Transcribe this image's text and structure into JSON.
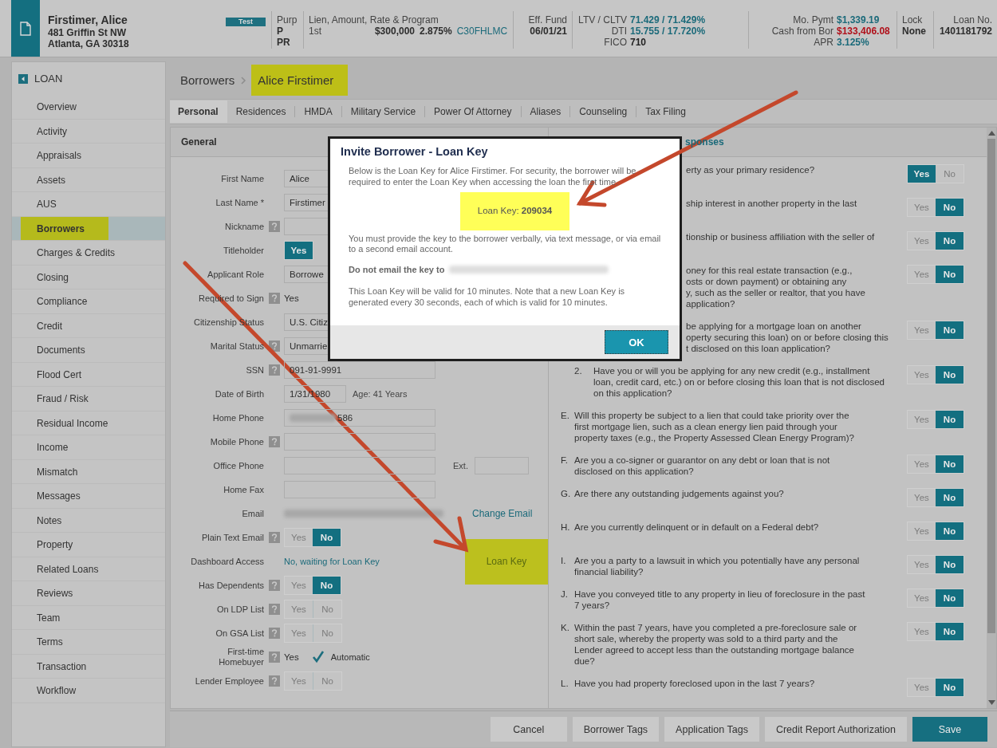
{
  "header": {
    "name": "Firstimer, Alice",
    "address": [
      "481 Griffin St NW",
      "Atlanta, GA 30318"
    ],
    "badge": "Test",
    "purpose": {
      "label": "Purp",
      "values": [
        "P",
        "PR"
      ]
    },
    "lien": {
      "label": "Lien, Amount, Rate & Program",
      "position": "1st",
      "amount": "$300,000",
      "rate": "2.875%",
      "program": "C30FHLMC"
    },
    "funding": {
      "label": "Eff. Fund",
      "value": "06/01/21"
    },
    "ratios": [
      {
        "label": "LTV / CLTV",
        "value": "71.429 / 71.429%",
        "color": "#1b6a7a"
      },
      {
        "label": "DTI",
        "value": "15.755 / 17.720%",
        "color": "#1b6a7a"
      },
      {
        "label": "FICO",
        "value": "710",
        "color": "#222222"
      }
    ],
    "payment": [
      {
        "label": "Mo. Pymt",
        "value": "$1,339.19",
        "color": "#1b6a7a"
      },
      {
        "label": "Cash from Bor",
        "value": "$133,406.08",
        "color": "#b0101a"
      },
      {
        "label": "APR",
        "value": "3.125%",
        "color": "#1b6a7a"
      }
    ],
    "lock": {
      "label": "Lock",
      "value": "None"
    },
    "loan_no": {
      "label": "Loan No.",
      "value": "1401181792"
    }
  },
  "sidebar": {
    "title": "LOAN",
    "items": [
      {
        "label": "Overview",
        "selected": false,
        "highlighted": false
      },
      {
        "label": "Activity",
        "selected": false,
        "highlighted": false
      },
      {
        "label": "Appraisals",
        "selected": false,
        "highlighted": false
      },
      {
        "label": "Assets",
        "selected": false,
        "highlighted": false
      },
      {
        "label": "AUS",
        "selected": false,
        "highlighted": false
      },
      {
        "label": "Borrowers",
        "selected": true,
        "highlighted": true
      },
      {
        "label": "Charges & Credits",
        "selected": false,
        "highlighted": false
      },
      {
        "label": "Closing",
        "selected": false,
        "highlighted": false
      },
      {
        "label": "Compliance",
        "selected": false,
        "highlighted": false
      },
      {
        "label": "Credit",
        "selected": false,
        "highlighted": false
      },
      {
        "label": "Documents",
        "selected": false,
        "highlighted": false
      },
      {
        "label": "Flood Cert",
        "selected": false,
        "highlighted": false
      },
      {
        "label": "Fraud / Risk",
        "selected": false,
        "highlighted": false
      },
      {
        "label": "Residual Income",
        "selected": false,
        "highlighted": false
      },
      {
        "label": "Income",
        "selected": false,
        "highlighted": false
      },
      {
        "label": "Mismatch",
        "selected": false,
        "highlighted": false
      },
      {
        "label": "Messages",
        "selected": false,
        "highlighted": false
      },
      {
        "label": "Notes",
        "selected": false,
        "highlighted": false
      },
      {
        "label": "Property",
        "selected": false,
        "highlighted": false
      },
      {
        "label": "Related Loans",
        "selected": false,
        "highlighted": false
      },
      {
        "label": "Reviews",
        "selected": false,
        "highlighted": false
      },
      {
        "label": "Team",
        "selected": false,
        "highlighted": false
      },
      {
        "label": "Terms",
        "selected": false,
        "highlighted": false
      },
      {
        "label": "Transaction",
        "selected": false,
        "highlighted": false
      },
      {
        "label": "Workflow",
        "selected": false,
        "highlighted": false
      }
    ]
  },
  "breadcrumb": [
    {
      "label": "Borrowers",
      "highlighted": false
    },
    {
      "label": "Alice Firstimer",
      "highlighted": true
    }
  ],
  "tabs": [
    {
      "label": "Personal",
      "selected": true
    },
    {
      "label": "Residences",
      "selected": false
    },
    {
      "label": "HMDA",
      "selected": false
    },
    {
      "label": "Military Service",
      "selected": false
    },
    {
      "label": "Power Of Attorney",
      "selected": false
    },
    {
      "label": "Aliases",
      "selected": false
    },
    {
      "label": "Counseling",
      "selected": false
    },
    {
      "label": "Tax Filing",
      "selected": false
    }
  ],
  "general": {
    "title": "General",
    "rows": [
      {
        "label": "First Name",
        "help": false,
        "kind": "input",
        "value": "Alice"
      },
      {
        "label": "Last Name *",
        "help": false,
        "kind": "input",
        "value": "Firstimer"
      },
      {
        "label": "Nickname",
        "help": true,
        "kind": "input"
      },
      {
        "label": "Titleholder",
        "help": false,
        "kind": "toggle",
        "options": [
          {
            "label": "Yes",
            "selected": true
          }
        ]
      },
      {
        "label": "Applicant Role",
        "help": false,
        "kind": "input",
        "value": "Borrowe"
      },
      {
        "label": "Required to Sign",
        "help": true,
        "kind": "text",
        "value": "Yes"
      },
      {
        "label": "Citizenship Status",
        "help": false,
        "kind": "input",
        "value": "U.S. Citiz"
      },
      {
        "label": "Marital Status",
        "help": true,
        "kind": "input",
        "value": "Unmarrie"
      },
      {
        "label": "SSN",
        "help": true,
        "kind": "input",
        "value": "091-91-9991"
      },
      {
        "label": "Date of Birth",
        "help": false,
        "kind": "date",
        "value": "1/31/1980",
        "note": "Age: 41 Years"
      },
      {
        "label": "Home Phone",
        "help": false,
        "kind": "input",
        "value": "586",
        "redacted": true
      },
      {
        "label": "Mobile Phone",
        "help": true,
        "kind": "input"
      },
      {
        "label": "Office Phone",
        "help": false,
        "kind": "input",
        "ext_label": "Ext."
      },
      {
        "label": "Home Fax",
        "help": false,
        "kind": "input"
      },
      {
        "label": "Email",
        "help": false,
        "kind": "email",
        "link": "Change Email"
      },
      {
        "label": "Plain Text Email",
        "help": true,
        "kind": "toggle",
        "options": [
          {
            "label": "Yes",
            "selected": false
          },
          {
            "label": "No",
            "selected": true
          }
        ]
      },
      {
        "label": "Dashboard Access",
        "help": false,
        "kind": "status",
        "value": "No, waiting for Loan Key",
        "button": {
          "label": "Loan Key",
          "highlighted": true
        }
      },
      {
        "label": "Has Dependents",
        "help": true,
        "kind": "toggle",
        "options": [
          {
            "label": "Yes",
            "selected": false
          },
          {
            "label": "No",
            "selected": true
          }
        ]
      },
      {
        "label": "On LDP List",
        "help": true,
        "kind": "toggle",
        "options": [
          {
            "label": "Yes",
            "selected": false
          },
          {
            "label": "No",
            "selected": false
          }
        ]
      },
      {
        "label": "On GSA List",
        "help": true,
        "kind": "toggle",
        "options": [
          {
            "label": "Yes",
            "selected": false
          },
          {
            "label": "No",
            "selected": false
          }
        ]
      },
      {
        "label": "First-time Homebuyer",
        "help": true,
        "kind": "text",
        "value": "Yes",
        "checkbox": {
          "label": "Automatic",
          "checked": true
        }
      },
      {
        "label": "Lender Employee",
        "help": true,
        "kind": "toggle",
        "options": [
          {
            "label": "Yes",
            "selected": false
          },
          {
            "label": "No",
            "selected": false
          }
        ]
      }
    ]
  },
  "declarations": {
    "title": "sponses",
    "questions": [
      {
        "kind": "clipped",
        "lines": [
          "erty as your primary residence?"
        ],
        "options": [
          {
            "label": "Yes",
            "selected": true
          },
          {
            "label": "No",
            "selected": false
          }
        ]
      },
      {
        "kind": "clipped",
        "lines": [
          "ship interest in another property in the last"
        ],
        "options": [
          {
            "label": "Yes",
            "selected": false
          },
          {
            "label": "No",
            "selected": true
          }
        ]
      },
      {
        "kind": "clipped",
        "lines": [
          "tionship or business affiliation with the seller of"
        ],
        "options": [
          {
            "label": "Yes",
            "selected": false
          },
          {
            "label": "No",
            "selected": true
          }
        ]
      },
      {
        "kind": "clipped",
        "lines": [
          "oney for this real estate transaction (e.g.,",
          "osts or down payment) or obtaining any",
          "y, such as the seller or realtor, that you have",
          "application?"
        ],
        "options": [
          {
            "label": "Yes",
            "selected": false
          },
          {
            "label": "No",
            "selected": true
          }
        ]
      },
      {
        "kind": "clipped",
        "lines": [
          "be applying for a mortgage loan on another",
          "operty securing this loan) on or before closing this",
          "t disclosed on this loan application?"
        ],
        "options": [
          {
            "label": "Yes",
            "selected": false
          },
          {
            "label": "No",
            "selected": true
          }
        ]
      },
      {
        "kind": "numbered",
        "marker": "2.",
        "lines": [
          "Have you or will you be applying for any new credit (e.g., installment",
          "loan, credit card, etc.) on or before closing this loan that is not disclosed",
          "on this application?"
        ],
        "options": [
          {
            "label": "Yes",
            "selected": false
          },
          {
            "label": "No",
            "selected": true
          }
        ]
      },
      {
        "kind": "lettered",
        "marker": "E.",
        "lines": [
          "Will this property be subject to a lien that could take priority over the",
          "first mortgage lien, such as a clean energy lien paid through your",
          "property taxes (e.g., the Property Assessed Clean Energy Program)?"
        ],
        "options": [
          {
            "label": "Yes",
            "selected": false
          },
          {
            "label": "No",
            "selected": true
          }
        ]
      },
      {
        "kind": "lettered",
        "marker": "F.",
        "lines": [
          "Are you a co-signer or guarantor on any debt or loan that is not",
          "disclosed on this application?"
        ],
        "options": [
          {
            "label": "Yes",
            "selected": false
          },
          {
            "label": "No",
            "selected": true
          }
        ]
      },
      {
        "kind": "lettered",
        "marker": "G.",
        "lines": [
          "Are there any outstanding judgements against you?"
        ],
        "options": [
          {
            "label": "Yes",
            "selected": false
          },
          {
            "label": "No",
            "selected": true
          }
        ]
      },
      {
        "kind": "lettered",
        "marker": "H.",
        "lines": [
          "Are you currently delinquent or in default on a Federal debt?"
        ],
        "options": [
          {
            "label": "Yes",
            "selected": false
          },
          {
            "label": "No",
            "selected": true
          }
        ]
      },
      {
        "kind": "lettered",
        "marker": "I.",
        "lines": [
          "Are you a party to a lawsuit in which you potentially have any personal",
          "financial liability?"
        ],
        "options": [
          {
            "label": "Yes",
            "selected": false
          },
          {
            "label": "No",
            "selected": true
          }
        ]
      },
      {
        "kind": "lettered",
        "marker": "J.",
        "lines": [
          "Have you conveyed title to any property in lieu of foreclosure in the past",
          "7 years?"
        ],
        "options": [
          {
            "label": "Yes",
            "selected": false
          },
          {
            "label": "No",
            "selected": true
          }
        ]
      },
      {
        "kind": "lettered",
        "marker": "K.",
        "lines": [
          "Within the past 7 years, have you completed a pre-foreclosure sale or",
          "short sale, whereby the property was sold to a third party and the",
          "Lender agreed to accept less than the outstanding mortgage balance",
          "due?"
        ],
        "options": [
          {
            "label": "Yes",
            "selected": false
          },
          {
            "label": "No",
            "selected": true
          }
        ]
      },
      {
        "kind": "lettered",
        "marker": "L.",
        "lines": [
          "Have you had property foreclosed upon in the last 7 years?"
        ],
        "options": [
          {
            "label": "Yes",
            "selected": false
          },
          {
            "label": "No",
            "selected": true
          }
        ]
      }
    ]
  },
  "footer_buttons": [
    {
      "label": "Cancel",
      "primary": false
    },
    {
      "label": "Borrower Tags",
      "primary": false
    },
    {
      "label": "Application Tags",
      "primary": false
    },
    {
      "label": "Credit Report Authorization",
      "primary": false
    },
    {
      "label": "Save",
      "primary": true
    }
  ],
  "dialog": {
    "title": "Invite Borrower - Loan Key",
    "intro": "Below is the Loan Key for Alice Firstimer. For security, the borrower will be required to enter the Loan Key when accessing the loan the first time.",
    "key": {
      "text": "Loan Key: **209034**",
      "highlighted": true
    },
    "instructions": "You must provide the key to the borrower verbally, via text message, or via email to a second email account.",
    "warning": "Do not email the key to",
    "validity": "This Loan Key will be valid for 10 minutes. Note that a new Loan Key is generated every 30 seconds, each of which is valid for 10 minutes.",
    "ok": "OK"
  }
}
